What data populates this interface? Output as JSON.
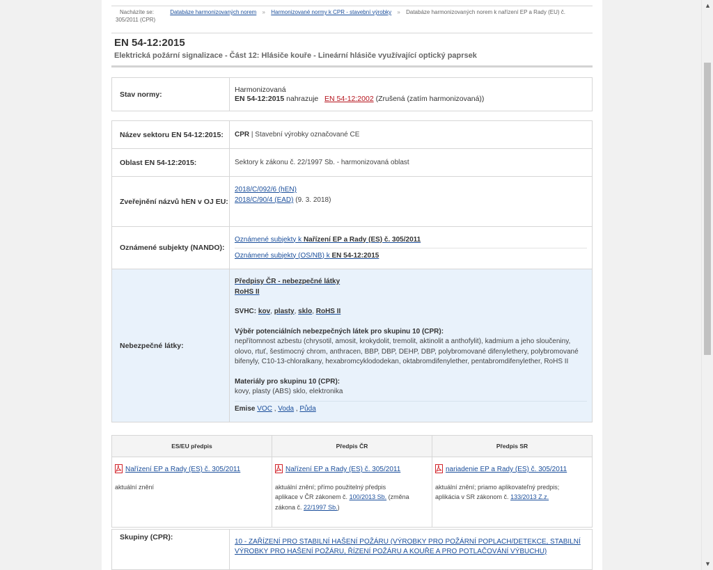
{
  "breadcrumb": {
    "label": "Nacházíte se:",
    "items": [
      "Databáze harmonizovaných norem",
      "Harmonizované normy k CPR - stavební výrobky",
      "Databáze harmonizovaných norem k nařízení EP a Rady (EU) č. 305/2011 (CPR)"
    ],
    "separator": "»"
  },
  "title": "EN 54-12:2015",
  "subtitle": "Elektrická požární signalizace - Část 12: Hlásiče kouře - Lineární hlásiče využívající optický paprsek",
  "stav": {
    "label": "Stav normy:",
    "status": "Harmonizovaná",
    "code": "EN 54-12:2015",
    "replaces_text": "nahrazuje",
    "replaced_code": "EN 54-12:2002",
    "replaced_note": "(Zrušená (zatím harmonizovaná))"
  },
  "sector": {
    "label": "Název sektoru EN 54-12:2015:",
    "bold": "CPR",
    "text": "| Stavební výrobky označované CE"
  },
  "oblast": {
    "label": "Oblast EN 54-12:2015:",
    "text": "Sektory k zákonu č. 22/1997 Sb. - harmonizovaná oblast"
  },
  "oj": {
    "label": "Zveřejnění názvů hEN v OJ EU:",
    "link1": "2018/C/092/6 (hEN)",
    "link2": "2018/C/90/4 (EAD)",
    "date": "(9. 3. 2018)"
  },
  "nando": {
    "label": "Oznámené subjekty (NANDO):",
    "line1_prefix": "Oznámené subjekty k",
    "line1_bold": "Nařízení EP a Rady (ES) č. 305/2011",
    "line2_prefix": "Oznámené subjekty (OS/NB) k",
    "line2_bold": "EN 54-12:2015"
  },
  "dangerous": {
    "label": "Nebezpečné látky:",
    "link1": "Předpisy ČR - nebezpečné látky",
    "link2": "RoHS II",
    "svhc_label": "SVHC:",
    "svhc_items": [
      "kov",
      "plasty",
      "sklo",
      "RoHS II"
    ],
    "vyber_title": "Výběr potenciálních nebezpečných látek pro skupinu 10 (CPR):",
    "vyber_text": "nepřítomnost azbestu (chrysotil, amosit, krokydolit, tremolit, aktinolit a anthofylit), kadmium a jeho sloučeniny, olovo, rtuť, šestimocný chrom, anthracen, BBP, DBP, DEHP, DBP, polybromované difenylethery, polybromované bifenyly, C10-13-chloralkany, hexabromcyklododekan, oktabromdifenylether, pentabromdifenylether, RoHS II",
    "materialy_title": "Materiály pro skupinu 10 (CPR):",
    "materialy_text": "kovy, plasty (ABS) sklo, elektronika",
    "emise_label": "Emise",
    "emise_items": [
      "VOC",
      "Voda",
      "Půda"
    ]
  },
  "predpisy": {
    "headers": [
      "ES/EU předpis",
      "Předpis ČR",
      "Předpis SR"
    ],
    "col1": {
      "link": "Nařízení EP a Rady (ES) č. 305/2011",
      "note": "aktuální znění"
    },
    "col2": {
      "link": "Nařízení EP a Rady (ES) č. 305/2011",
      "note1": "aktuální znění; přímo použitelný předpis",
      "note2_prefix": "aplikace v ČR zákonem č.",
      "note2_link": "100/2013 Sb.",
      "note2_mid": "(změna zákona č.",
      "note2_link2": "22/1997 Sb.",
      "note2_end": ")"
    },
    "col3": {
      "link": "nariadenie EP a Rady (ES) č. 305/2011",
      "note1": "aktuální znění;  priamo aplikovateľný predpis;",
      "note2_prefix": "aplikácia v SR zákonom č.",
      "note2_link": "133/2013 Z.z."
    }
  },
  "skupiny": {
    "label": "Skupiny (CPR):",
    "link": "10 - ZAŘÍZENÍ PRO STABILNÍ HAŠENÍ POŽÁRU (VÝROBKY PRO POŽÁRNÍ POPLACH/DETEKCE, STABILNÍ VÝROBKY PRO HAŠENÍ POŽÁRU, ŘÍZENÍ POŽÁRU A KOUŘE A PRO POTLAČOVÁNÍ VÝBUCHU)"
  },
  "colors": {
    "link": "#1a4e9b",
    "red_link": "#b5121b",
    "highlight": "#e9f2fb",
    "pdf": "#d2232a"
  }
}
